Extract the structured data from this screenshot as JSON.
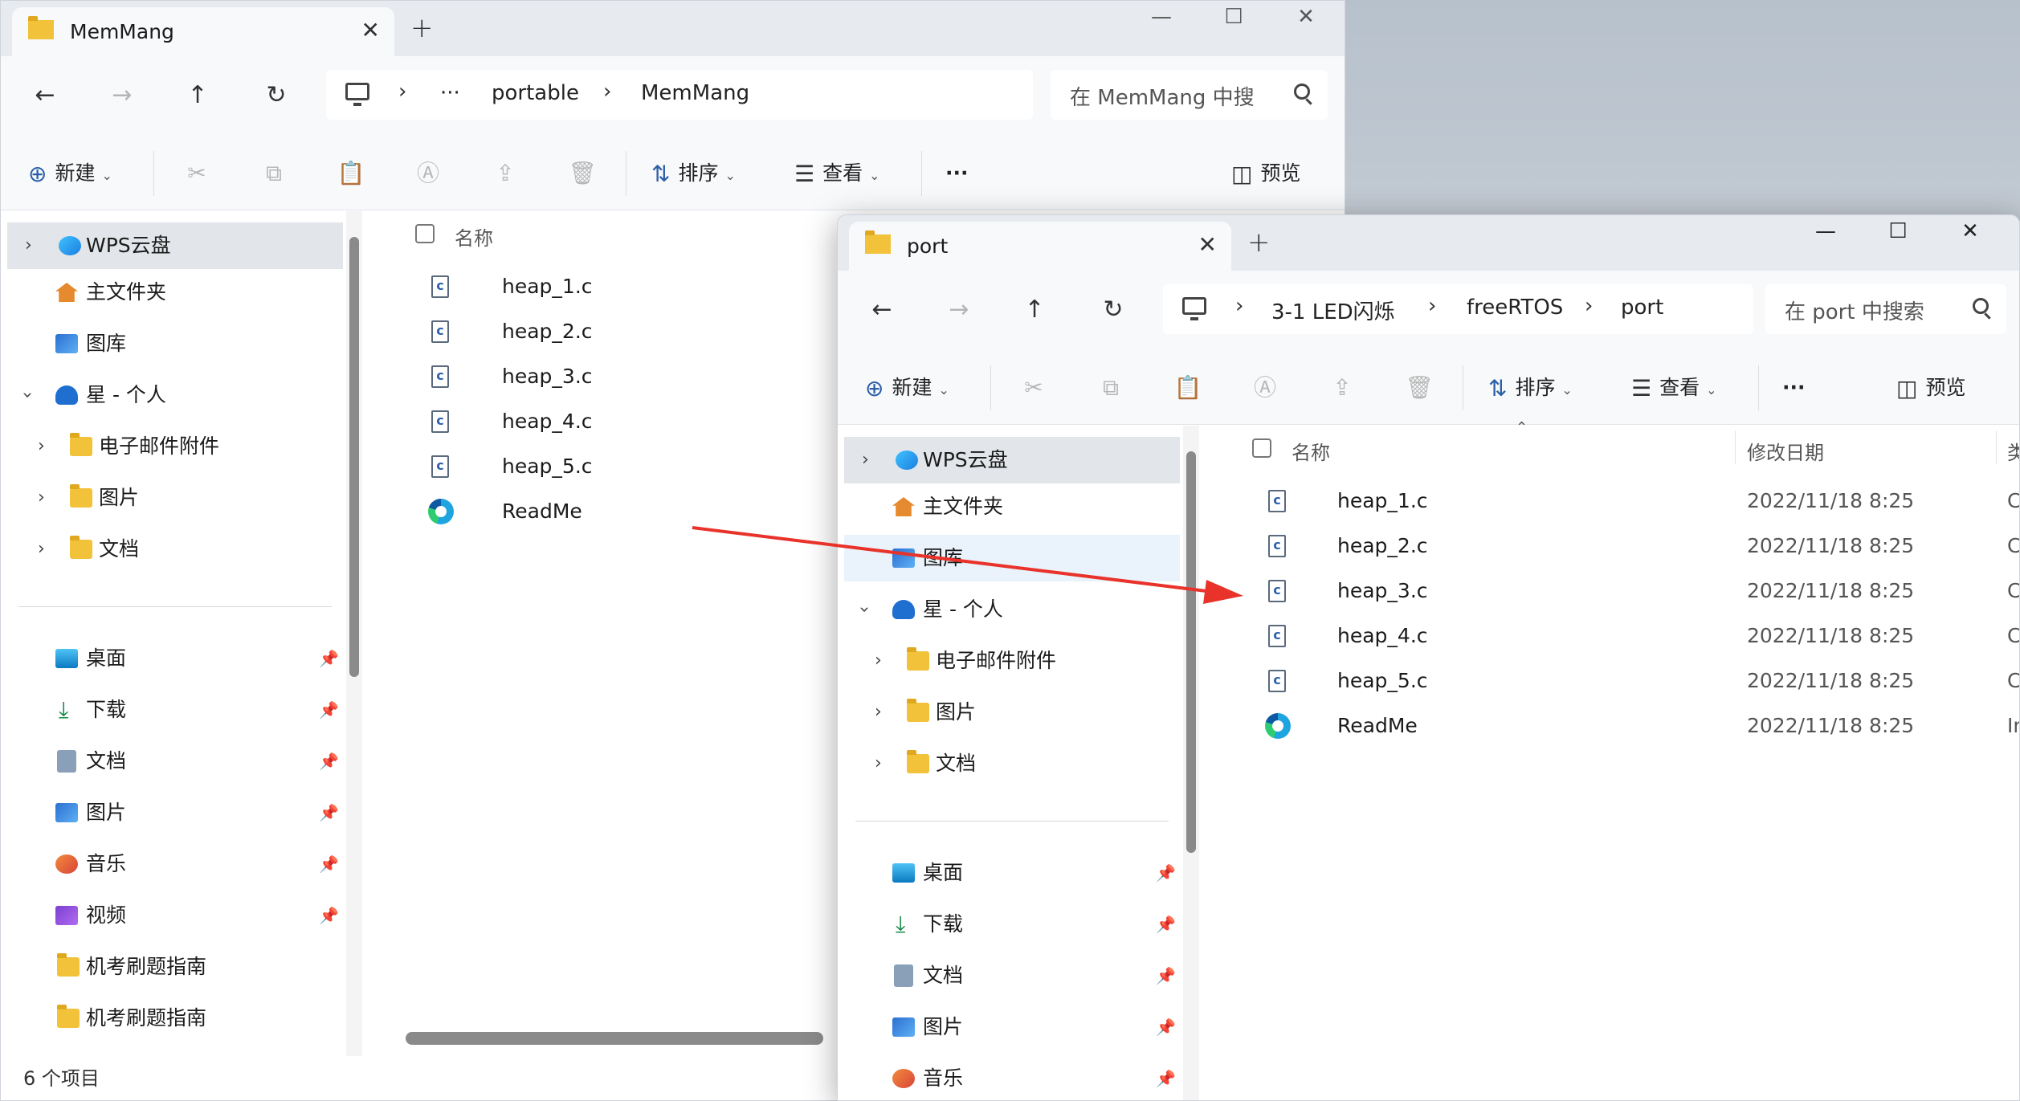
{
  "colors": {
    "accent": "#2d5fa8",
    "folder": "#f2c23b",
    "arrow": "#e8322a",
    "selected": "#e2e5e9"
  },
  "window1": {
    "tab_title": "MemMang",
    "breadcrumbs": [
      "···",
      "portable",
      "MemMang"
    ],
    "search_placeholder": "在 MemMang 中搜",
    "commands": {
      "new": "新建",
      "sort": "排序",
      "view": "查看",
      "more": "···",
      "preview": "预览"
    },
    "nav_items": [
      "WPS云盘",
      "主文件夹",
      "图库",
      "星 - 个人",
      "电子邮件附件",
      "图片",
      "文档"
    ],
    "quick_access": [
      "桌面",
      "下载",
      "文档",
      "图片",
      "音乐",
      "视频",
      "机考刷题指南",
      "机考刷题指南"
    ],
    "column_name": "名称",
    "files": [
      "heap_1.c",
      "heap_2.c",
      "heap_3.c",
      "heap_4.c",
      "heap_5.c",
      "ReadMe"
    ],
    "status": "6 个项目"
  },
  "window2": {
    "tab_title": "port",
    "breadcrumbs": [
      "3-1 LED闪烁",
      "freeRTOS",
      "port"
    ],
    "search_placeholder": "在 port 中搜索",
    "commands": {
      "new": "新建",
      "sort": "排序",
      "view": "查看",
      "more": "···",
      "preview": "预览"
    },
    "nav_items": [
      "WPS云盘",
      "主文件夹",
      "图库",
      "星 - 个人",
      "电子邮件附件",
      "图片",
      "文档"
    ],
    "quick_access": [
      "桌面",
      "下载",
      "文档",
      "图片",
      "音乐"
    ],
    "columns": {
      "name": "名称",
      "date": "修改日期",
      "type": "类型"
    },
    "files": [
      {
        "name": "heap_1.c",
        "date": "2022/11/18 8:25",
        "type": "C 源"
      },
      {
        "name": "heap_2.c",
        "date": "2022/11/18 8:25",
        "type": "C 源"
      },
      {
        "name": "heap_3.c",
        "date": "2022/11/18 8:25",
        "type": "C 源"
      },
      {
        "name": "heap_4.c",
        "date": "2022/11/18 8:25",
        "type": "C 源"
      },
      {
        "name": "heap_5.c",
        "date": "2022/11/18 8:25",
        "type": "C 源"
      },
      {
        "name": "ReadMe",
        "date": "2022/11/18 8:25",
        "type": "Inte"
      }
    ]
  }
}
